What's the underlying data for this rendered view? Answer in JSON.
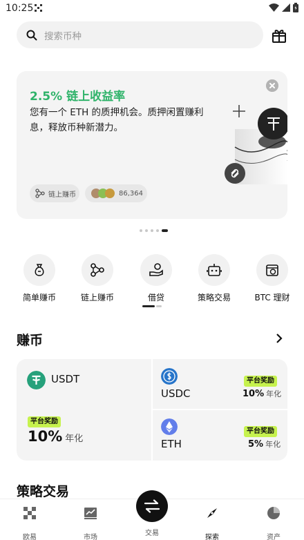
{
  "status_bar": {
    "time": "10:25"
  },
  "search": {
    "placeholder": "搜索币种"
  },
  "promo": {
    "title": "2.5% 链上收益率",
    "description": "您有一个 ETH 的质押机会。质押闲置赚利息，释放币种新潜力。",
    "chip_label": "链上赚币",
    "participants": "86,364",
    "page_count": 5,
    "active_page": 5
  },
  "quick_actions": [
    {
      "label": "简单赚币",
      "icon": "money-bag-icon"
    },
    {
      "label": "链上赚币",
      "icon": "onchain-nodes-icon"
    },
    {
      "label": "借贷",
      "icon": "loan-hand-coin-icon"
    },
    {
      "label": "策略交易",
      "icon": "robot-icon"
    },
    {
      "label": "BTC 理财",
      "icon": "btc-wallet-icon"
    }
  ],
  "earn": {
    "title": "赚币",
    "badge": "平台奖励",
    "unit": "年化",
    "items": [
      {
        "coin": "USDT",
        "rate": "10%",
        "color": "#26a17b"
      },
      {
        "coin": "USDC",
        "rate": "10%",
        "color": "#2775ca"
      },
      {
        "coin": "ETH",
        "rate": "5%",
        "color": "#627eea"
      }
    ]
  },
  "strategy": {
    "title": "策略交易"
  },
  "bottom_nav": [
    {
      "label": "欧易",
      "icon": "okx-logo-icon"
    },
    {
      "label": "市场",
      "icon": "market-chart-icon"
    },
    {
      "label": "交易",
      "icon": "swap-arrows-icon"
    },
    {
      "label": "探索",
      "icon": "compass-icon",
      "active": true
    },
    {
      "label": "资产",
      "icon": "pie-chart-icon"
    }
  ],
  "colors": {
    "accent_green": "#2fb36a",
    "badge_lime": "#c6f24e"
  }
}
